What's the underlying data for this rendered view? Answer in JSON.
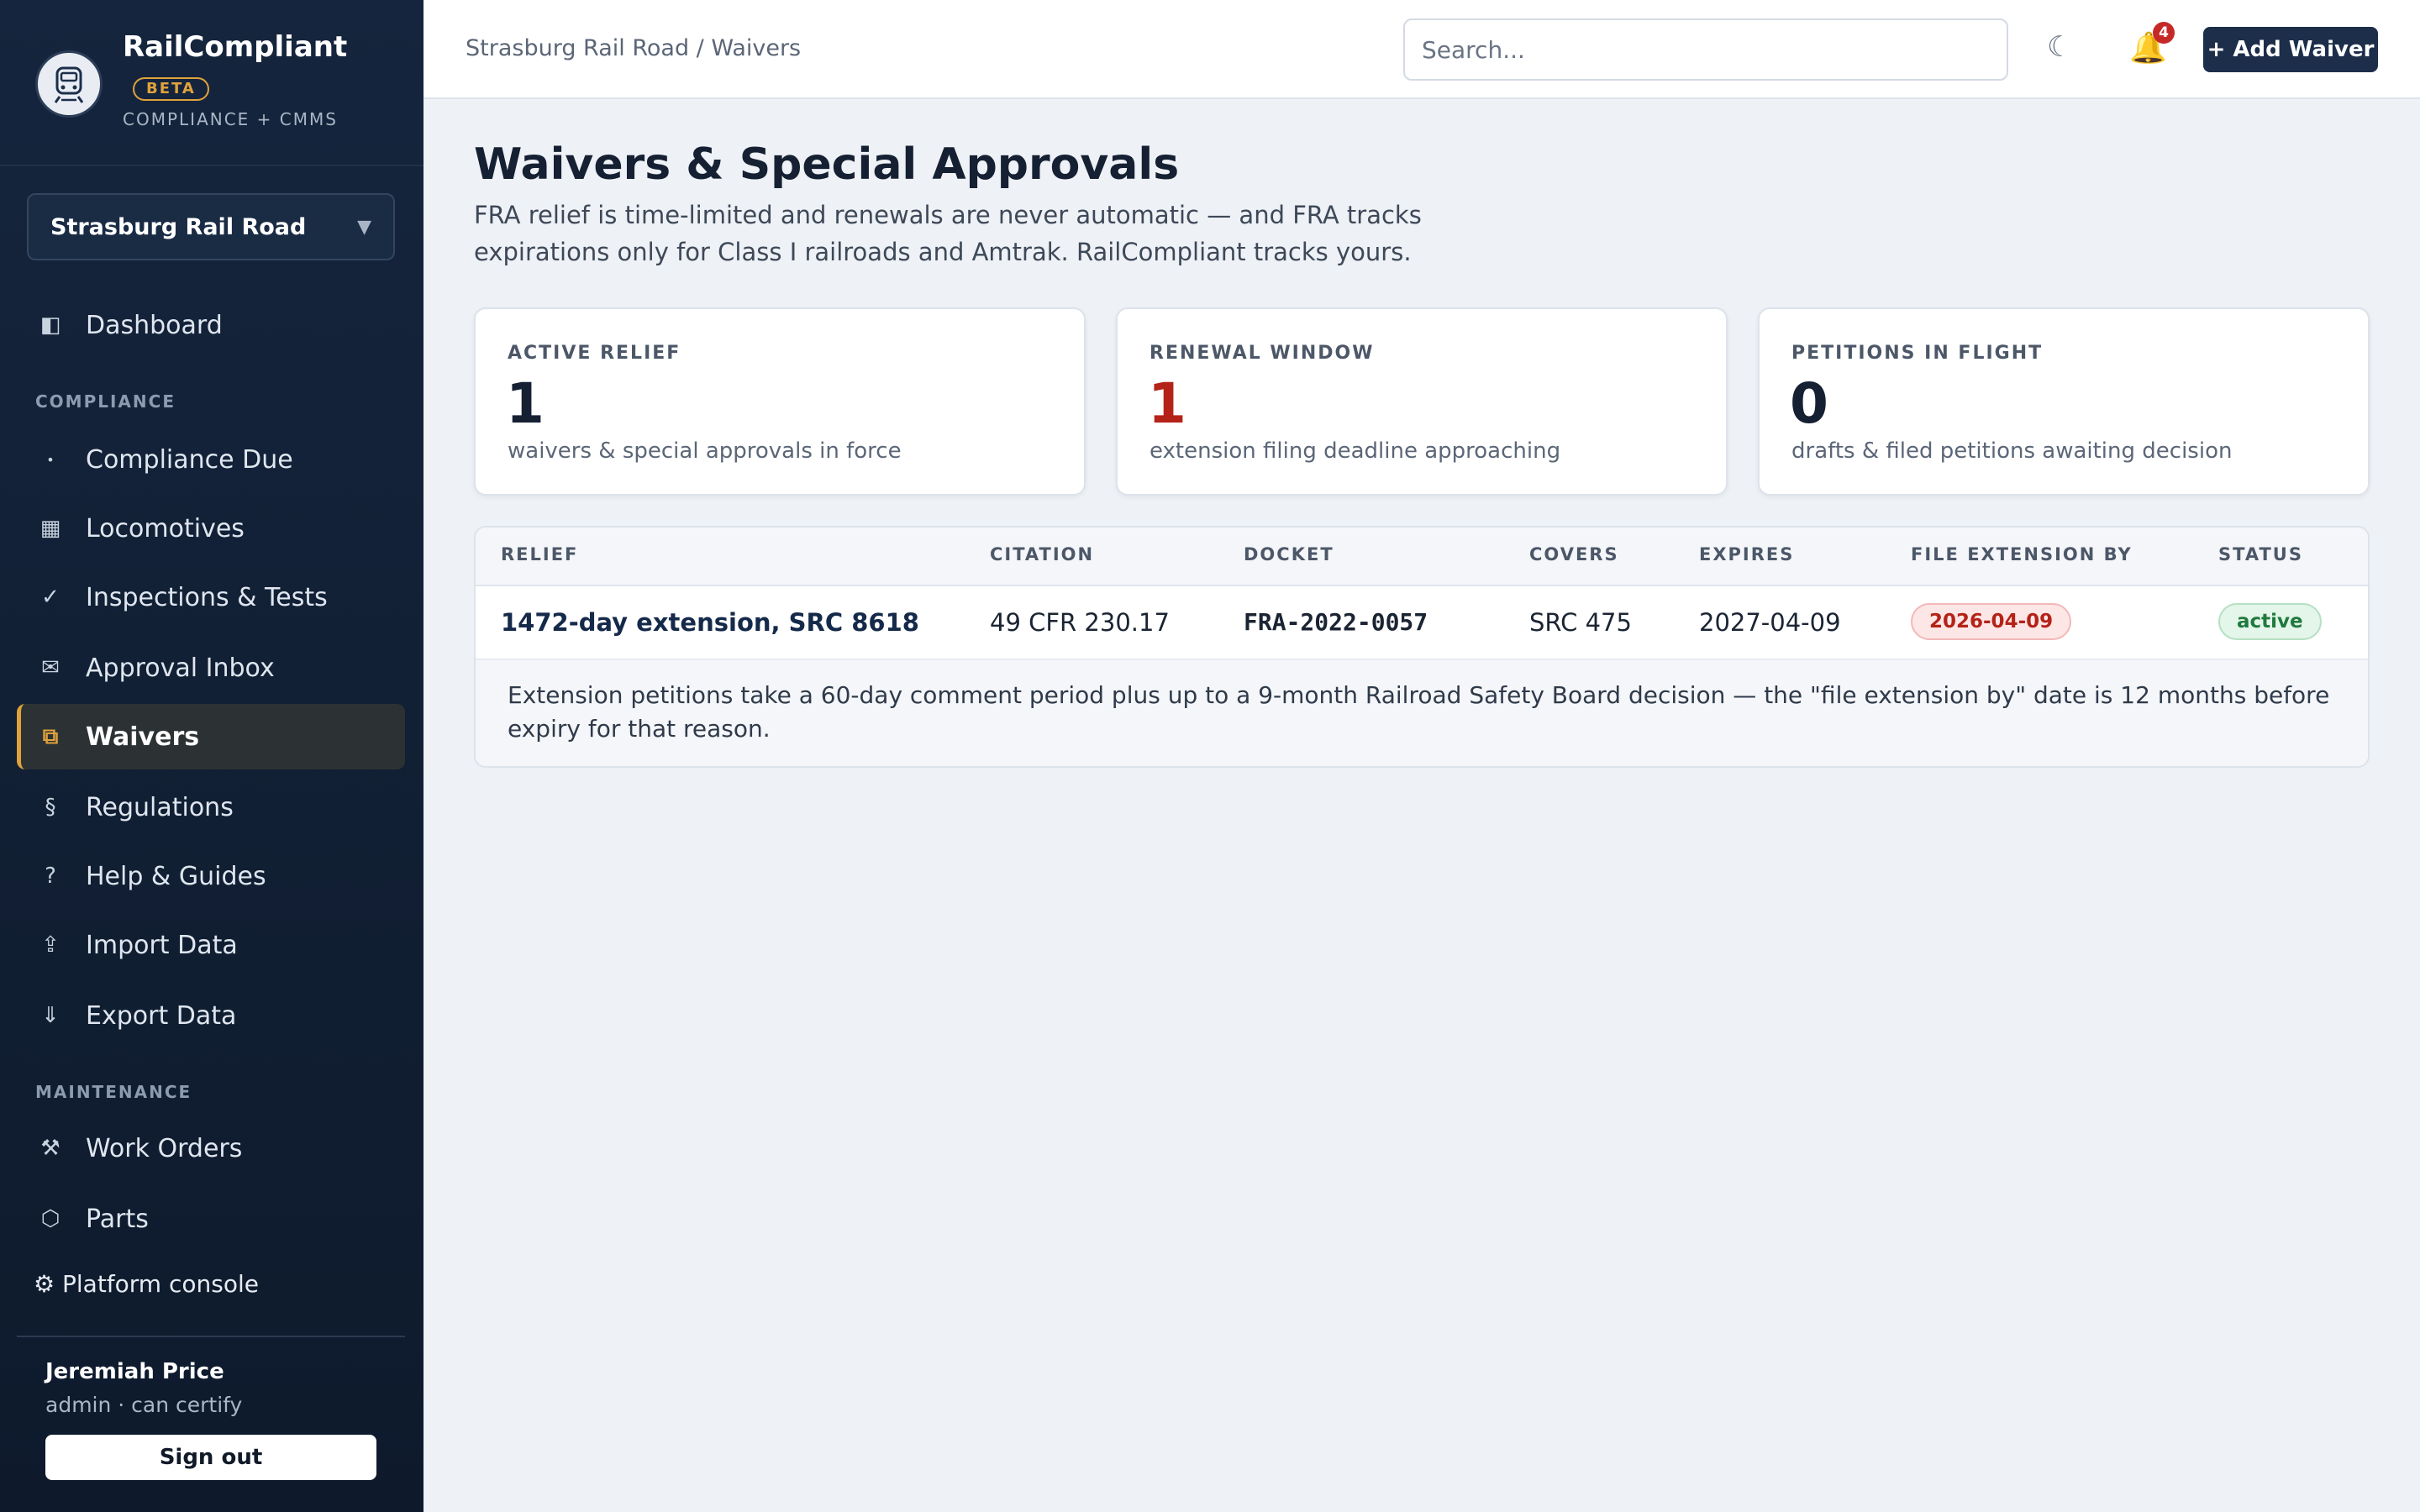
{
  "brand": {
    "name": "RailCompliant",
    "badge": "BETA",
    "subtitle": "COMPLIANCE + CMMS"
  },
  "railroad_select": {
    "value": "Strasburg Rail Road"
  },
  "nav": {
    "dashboard": {
      "label": "Dashboard",
      "icon": "dashboard-icon"
    },
    "compliance_section": "COMPLIANCE",
    "compliance_items": [
      {
        "label": "Compliance Due",
        "icon": "dot-icon"
      },
      {
        "label": "Locomotives",
        "icon": "grid-icon"
      },
      {
        "label": "Inspections & Tests",
        "icon": "check-icon"
      },
      {
        "label": "Approval Inbox",
        "icon": "envelope-icon"
      },
      {
        "label": "Waivers",
        "icon": "waiver-icon",
        "active": true
      },
      {
        "label": "Regulations",
        "icon": "section-icon"
      },
      {
        "label": "Help & Guides",
        "icon": "help-icon"
      },
      {
        "label": "Import Data",
        "icon": "upload-icon"
      },
      {
        "label": "Export Data",
        "icon": "download-icon"
      }
    ],
    "maintenance_section": "MAINTENANCE",
    "maintenance_items": [
      {
        "label": "Work Orders",
        "icon": "tools-icon"
      },
      {
        "label": "Parts",
        "icon": "hexagon-icon"
      }
    ],
    "platform_console": "⚙ Platform console"
  },
  "user": {
    "name": "Jeremiah Price",
    "role": "admin · can certify",
    "sign_out": "Sign out"
  },
  "topbar": {
    "breadcrumb": "Strasburg Rail Road / Waivers",
    "search_placeholder": "Search...",
    "notification_count": "4",
    "add_button": "+ Add Waiver"
  },
  "page": {
    "title": "Waivers & Special Approvals",
    "description": "FRA relief is time-limited and renewals are never automatic — and FRA tracks expirations only for Class I railroads and Amtrak. RailCompliant tracks yours."
  },
  "stats": [
    {
      "label": "ACTIVE RELIEF",
      "value": "1",
      "desc": "waivers & special approvals in force"
    },
    {
      "label": "RENEWAL WINDOW",
      "value": "1",
      "desc": "extension filing deadline approaching",
      "color": "#b42318"
    },
    {
      "label": "PETITIONS IN FLIGHT",
      "value": "0",
      "desc": "drafts & filed petitions awaiting decision"
    }
  ],
  "table": {
    "columns": [
      "RELIEF",
      "CITATION",
      "DOCKET",
      "COVERS",
      "EXPIRES",
      "FILE EXTENSION BY",
      "STATUS"
    ],
    "rows": [
      {
        "relief": "1472-day extension, SRC 8618",
        "citation": "49 CFR 230.17",
        "docket": "FRA-2022-0057",
        "covers": "SRC 475",
        "expires": "2027-04-09",
        "file_extension_by": "2026-04-09",
        "status": "active"
      }
    ],
    "note": "Extension petitions take a 60-day comment period plus up to a 9-month Railroad Safety Board decision — the \"file extension by\" date is 12 months before expiry for that reason."
  },
  "colors": {
    "sidebar_bg": "#15253d",
    "accent": "#e0a23c",
    "primary_button": "#1c2e4a",
    "warning": "#b42318",
    "success": "#1f7a3d"
  }
}
